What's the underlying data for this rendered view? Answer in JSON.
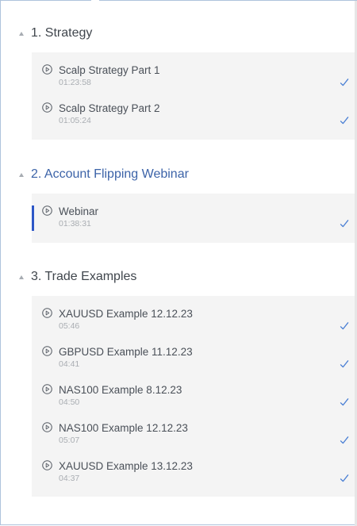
{
  "sections": [
    {
      "title": "1. Strategy",
      "active": false,
      "lessons": [
        {
          "title": "Scalp Strategy Part 1",
          "duration": "01:23:58",
          "completed": true
        },
        {
          "title": "Scalp Strategy Part 2",
          "duration": "01:05:24",
          "completed": true
        }
      ]
    },
    {
      "title": "2. Account Flipping Webinar",
      "active": true,
      "lessons": [
        {
          "title": "Webinar",
          "duration": "01:38:31",
          "completed": true,
          "current": true
        }
      ]
    },
    {
      "title": "3. Trade Examples",
      "active": false,
      "lessons": [
        {
          "title": "XAUUSD Example 12.12.23",
          "duration": "05:46",
          "completed": true
        },
        {
          "title": "GBPUSD Example 11.12.23",
          "duration": "04:41",
          "completed": true
        },
        {
          "title": "NAS100 Example 8.12.23",
          "duration": "04:50",
          "completed": true
        },
        {
          "title": "NAS100 Example 12.12.23",
          "duration": "05:07",
          "completed": true
        },
        {
          "title": "XAUUSD Example 13.12.23",
          "duration": "04:37",
          "completed": true
        }
      ]
    }
  ],
  "icons": {
    "collapse": "caret-up-icon",
    "play": "play-circle-icon",
    "completed": "checkmark-icon"
  },
  "colors": {
    "accent": "#3c63a8",
    "check": "#4a7fd4",
    "active_bar": "#2d57c7",
    "panel_bg": "#f4f4f4"
  }
}
